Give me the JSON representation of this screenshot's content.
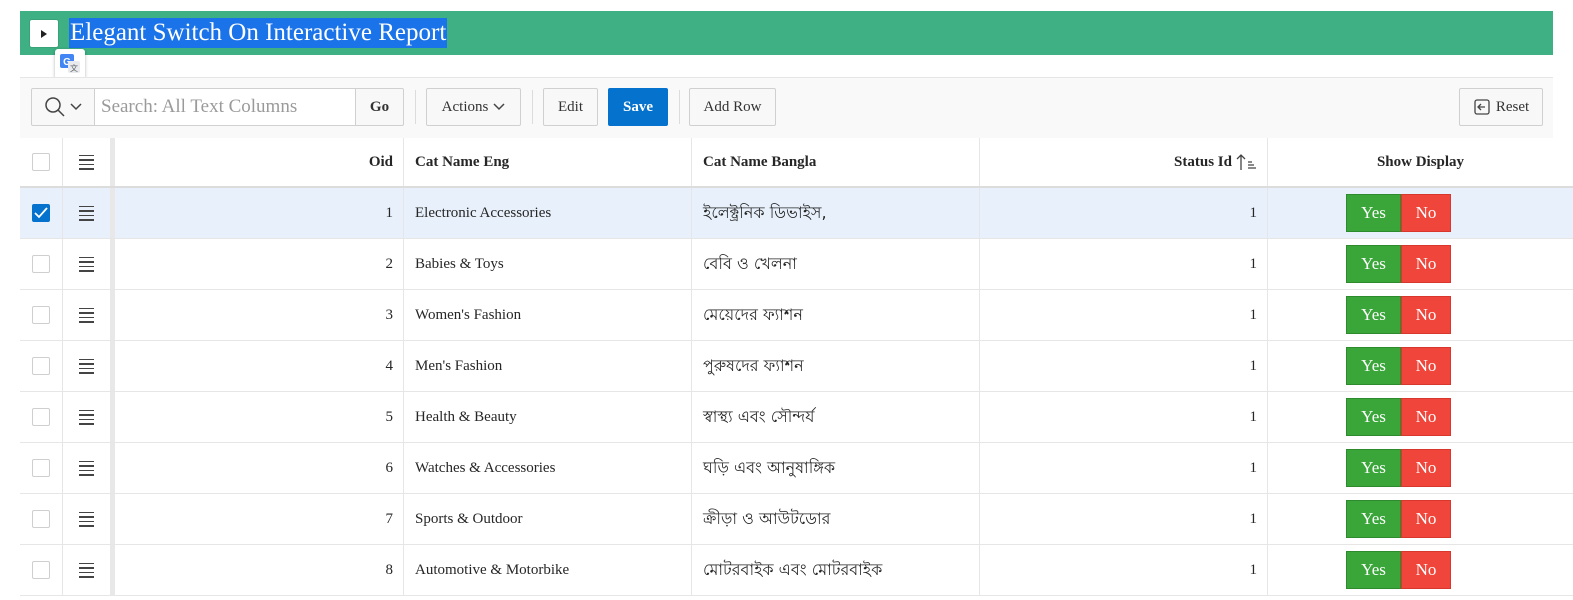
{
  "header": {
    "title": "Elegant Switch On Interactive Report"
  },
  "toolbar": {
    "search_placeholder": "Search: All Text Columns",
    "go_label": "Go",
    "actions_label": "Actions",
    "edit_label": "Edit",
    "save_label": "Save",
    "add_row_label": "Add Row",
    "reset_label": "Reset"
  },
  "columns": {
    "oid": "Oid",
    "cat_name_eng": "Cat Name Eng",
    "cat_name_bangla": "Cat Name Bangla",
    "status_id": "Status Id",
    "show_display": "Show Display"
  },
  "switch": {
    "yes": "Yes",
    "no": "No"
  },
  "rows": [
    {
      "oid": "1",
      "eng": "Electronic Accessories",
      "bn": "ইলেক্ট্রনিক ডিভাইস,",
      "status": "1",
      "selected": true
    },
    {
      "oid": "2",
      "eng": "Babies & Toys",
      "bn": "বেবি ও খেলনা",
      "status": "1",
      "selected": false
    },
    {
      "oid": "3",
      "eng": "Women's Fashion",
      "bn": "মেয়েদের ফ্যাশন",
      "status": "1",
      "selected": false
    },
    {
      "oid": "4",
      "eng": "Men's Fashion",
      "bn": "পুরুষদের ফ্যাশন",
      "status": "1",
      "selected": false
    },
    {
      "oid": "5",
      "eng": "Health & Beauty",
      "bn": "স্বাস্থ্য এবং সৌন্দর্য",
      "status": "1",
      "selected": false
    },
    {
      "oid": "6",
      "eng": "Watches & Accessories",
      "bn": "ঘড়ি এবং আনুষাঙ্গিক",
      "status": "1",
      "selected": false
    },
    {
      "oid": "7",
      "eng": "Sports & Outdoor",
      "bn": "ক্রীড়া ও আউটডোর",
      "status": "1",
      "selected": false
    },
    {
      "oid": "8",
      "eng": "Automotive & Motorbike",
      "bn": "মোটরবাইক এবং মোটরবাইক",
      "status": "1",
      "selected": false
    }
  ],
  "colors": {
    "header_bg": "#3eb083",
    "save_bg": "#0572ce",
    "yes_bg": "#3aa63a",
    "no_bg": "#f0453a",
    "selected_row": "#e8f1fb"
  },
  "icons": {
    "collapse": "triangle-right-icon",
    "translate": "google-translate-icon",
    "search": "search-icon",
    "actions": "chevron-down-icon",
    "reset": "reset-icon",
    "sort": "sort-ascending-icon",
    "row_actions": "menu-icon"
  }
}
